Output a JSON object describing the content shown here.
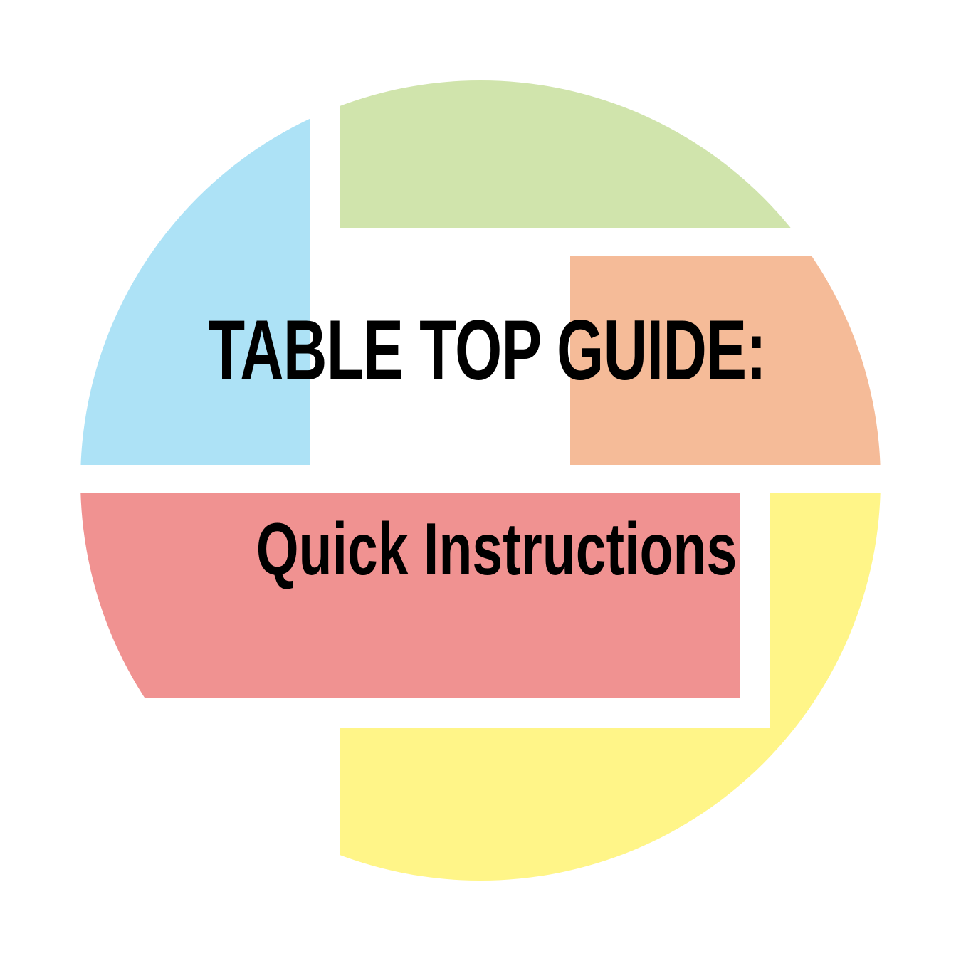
{
  "title": "TABLE TOP GUIDE:",
  "subtitle": "Quick Instructions",
  "colors": {
    "background": "#ffffff",
    "blue_segment": "#ade2f6",
    "green_segment": "#d0e4ac",
    "orange_segment": "#f5bb98",
    "red_segment": "#f09291",
    "yellow_segment": "#fff588",
    "text": "#000000"
  }
}
